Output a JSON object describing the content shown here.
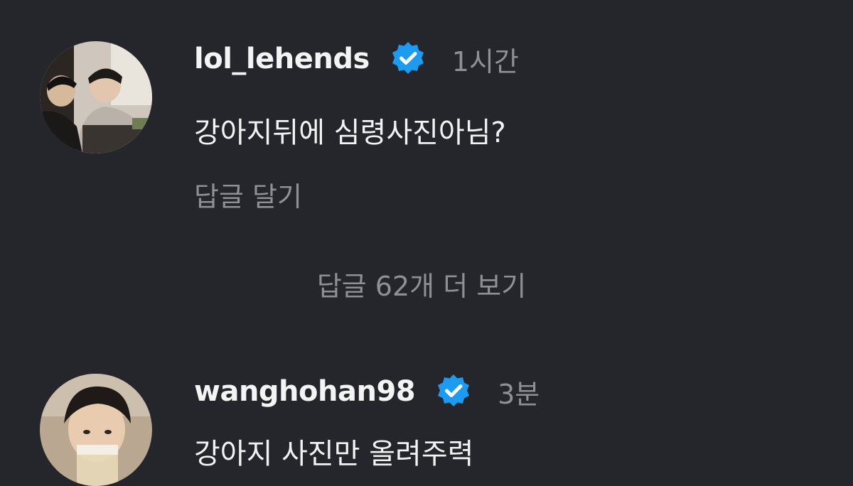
{
  "comments": [
    {
      "username": "lol_lehends",
      "verified_icon": "verified-badge-icon",
      "time": "1시간",
      "text": "강아지뒤에 심령사진아님?",
      "reply_label": "답글 달기"
    },
    {
      "username": "wanghohan98",
      "verified_icon": "verified-badge-icon",
      "time": "3분",
      "text": "강아지 사진만 올려주력"
    }
  ],
  "more_replies_label": "답글 62개 더 보기",
  "colors": {
    "background": "#25262b",
    "primary_text": "#f2f2f2",
    "secondary_text": "#8f9096",
    "verified_blue": "#1d9bf0"
  }
}
